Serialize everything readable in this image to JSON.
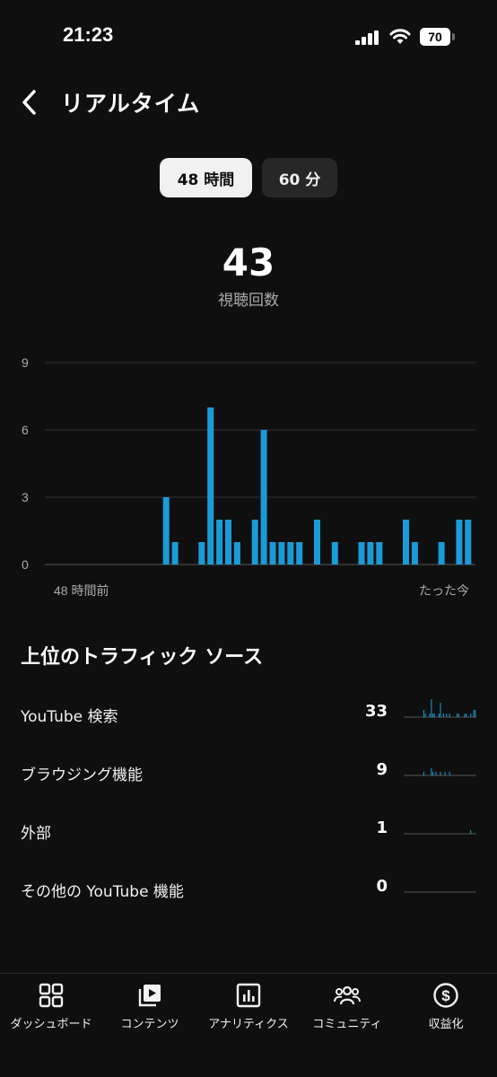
{
  "status_bar": {
    "time": "21:23",
    "battery": "70"
  },
  "header": {
    "title": "リアルタイム"
  },
  "toggle": {
    "option_48h": "48 時間",
    "option_60m": "60 分",
    "selected": "48h"
  },
  "summary": {
    "views": "43",
    "views_label": "視聴回数"
  },
  "chart_data": {
    "type": "bar",
    "y_ticks": [
      "9",
      "6",
      "3",
      "0"
    ],
    "ylim": [
      0,
      9
    ],
    "x_start_label": "48 時間前",
    "x_end_label": "たった今",
    "bar_color": "#1a9bd7",
    "grid": true,
    "values": [
      0,
      0,
      0,
      0,
      0,
      0,
      0,
      0,
      0,
      0,
      0,
      0,
      0,
      3,
      1,
      0,
      0,
      1,
      7,
      2,
      2,
      1,
      0,
      2,
      6,
      1,
      1,
      1,
      1,
      0,
      2,
      0,
      1,
      0,
      0,
      1,
      1,
      1,
      0,
      0,
      2,
      1,
      0,
      0,
      1,
      0,
      2,
      2
    ]
  },
  "traffic": {
    "heading": "上位のトラフィック ソース",
    "sources": [
      {
        "label": "YouTube 検索",
        "count": "33",
        "spark": [
          0,
          0,
          0,
          0,
          0,
          0,
          0,
          0,
          0,
          0,
          0,
          0,
          0,
          2,
          1,
          0,
          0,
          1,
          5,
          1,
          1,
          0,
          0,
          1,
          4,
          0,
          1,
          0,
          1,
          0,
          1,
          0,
          0,
          0,
          0,
          1,
          1,
          0,
          0,
          0,
          1,
          1,
          0,
          0,
          1,
          0,
          2,
          2
        ]
      },
      {
        "label": "ブラウジング機能",
        "count": "9",
        "spark": [
          0,
          0,
          0,
          0,
          0,
          0,
          0,
          0,
          0,
          0,
          0,
          0,
          0,
          1,
          0,
          0,
          0,
          0,
          2,
          1,
          0,
          1,
          0,
          0,
          1,
          0,
          0,
          1,
          0,
          0,
          1,
          0,
          0,
          0,
          0,
          0,
          0,
          0,
          0,
          0,
          0,
          0,
          0,
          0,
          0,
          0,
          0,
          0
        ]
      },
      {
        "label": "外部",
        "count": "1",
        "spark": [
          0,
          0,
          0,
          0,
          0,
          0,
          0,
          0,
          0,
          0,
          0,
          0,
          0,
          0,
          0,
          0,
          0,
          0,
          0,
          0,
          0,
          0,
          0,
          0,
          0,
          0,
          0,
          0,
          0,
          0,
          0,
          0,
          0,
          0,
          0,
          0,
          0,
          0,
          0,
          0,
          0,
          0,
          0,
          0,
          1,
          0,
          0,
          0
        ]
      },
      {
        "label": "その他の YouTube 機能",
        "count": "0",
        "spark": [
          0,
          0,
          0,
          0,
          0,
          0,
          0,
          0,
          0,
          0,
          0,
          0,
          0,
          0,
          0,
          0,
          0,
          0,
          0,
          0,
          0,
          0,
          0,
          0,
          0,
          0,
          0,
          0,
          0,
          0,
          0,
          0,
          0,
          0,
          0,
          0,
          0,
          0,
          0,
          0,
          0,
          0,
          0,
          0,
          0,
          0,
          0,
          0
        ]
      }
    ]
  },
  "nav": {
    "items": [
      {
        "label": "ダッシュボード",
        "icon": "dashboard-icon"
      },
      {
        "label": "コンテンツ",
        "icon": "content-icon"
      },
      {
        "label": "アナリティクス",
        "icon": "analytics-icon"
      },
      {
        "label": "コミュニティ",
        "icon": "community-icon"
      },
      {
        "label": "収益化",
        "icon": "monetization-icon"
      }
    ]
  }
}
